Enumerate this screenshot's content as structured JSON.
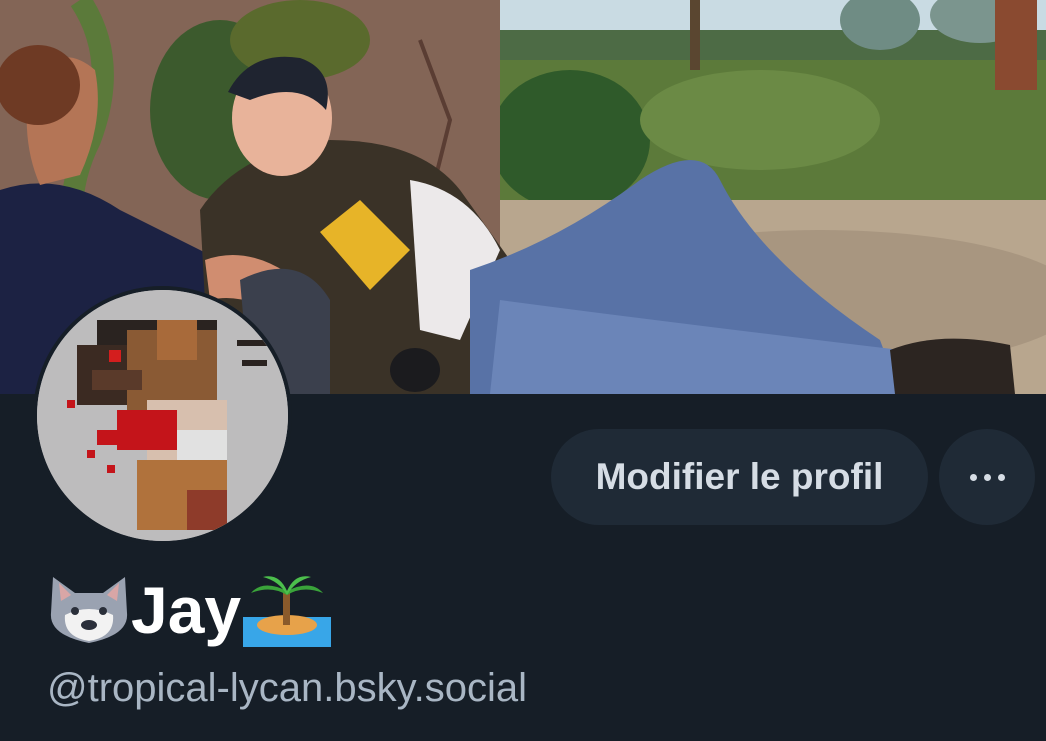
{
  "profile": {
    "display_name": "Jay",
    "name_prefix_icon": "wolf-face-emoji",
    "name_suffix_icon": "desert-island-emoji",
    "handle": "@tropical-lycan.bsky.social"
  },
  "actions": {
    "edit_profile_label": "Modifier le profil",
    "more_icon": "ellipsis-icon"
  },
  "colors": {
    "background": "#161e27",
    "button_background": "#1f2a36",
    "button_text": "#d6dde5",
    "name_text": "#ffffff",
    "handle_text": "#a9b6c4"
  }
}
